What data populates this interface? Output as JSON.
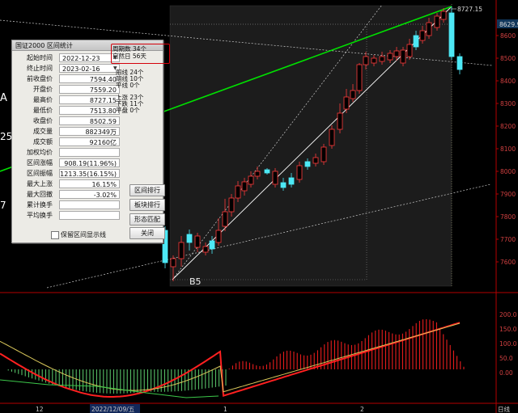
{
  "chart_data": {
    "type": "candlestick",
    "yticks": [
      "8600",
      "8500",
      "8400",
      "8300",
      "8200",
      "8100",
      "8000",
      "7900",
      "7800",
      "7700",
      "7600"
    ],
    "indicator_ticks": [
      "200.0",
      "150.0",
      "100.0",
      "50.0",
      "0.00"
    ],
    "price_tag": "8629.9",
    "high_label": "8727.15",
    "low_label": "B5",
    "x_labels": [
      "12",
      "2022/12/09/五",
      "1",
      "2"
    ],
    "bottom_right_label": "日线",
    "left_edge_labels": [
      "A",
      "25",
      "7"
    ],
    "colors": {
      "up": "#ff3b3b",
      "down": "#4de8f5",
      "trend": "#00dd00",
      "macd": "#ff2020",
      "signal": "#d8c65a"
    }
  },
  "dialog": {
    "title": "国证2000 区间统计",
    "start_label": "起始时间",
    "start_value": "2022-12-23",
    "end_label": "终止时间",
    "end_value": "2023-02-16",
    "fields": [
      {
        "label": "前收盘价",
        "value": "7594.40"
      },
      {
        "label": "开盘价",
        "value": "7559.20"
      },
      {
        "label": "最高价",
        "value": "8727.15"
      },
      {
        "label": "最低价",
        "value": "7513.80"
      },
      {
        "label": "收盘价",
        "value": "8502.59"
      },
      {
        "label": "成交量",
        "value": "882349万"
      },
      {
        "label": "成交额",
        "value": "92160亿"
      },
      {
        "label": "加权均价",
        "value": ""
      },
      {
        "label": "区间涨幅",
        "value": "908.19(11.96%)"
      },
      {
        "label": "区间振幅",
        "value": "1213.35(16.15%)"
      },
      {
        "label": "最大上涨",
        "value": "16.15%"
      },
      {
        "label": "最大回撤",
        "value": "-3.02%"
      },
      {
        "label": "累计换手",
        "value": ""
      },
      {
        "label": "平均换手",
        "value": ""
      }
    ],
    "period_label": "周期数",
    "period_value": "34个",
    "natural_label": "自然日",
    "natural_value": "56天",
    "yang_lines": "阳线 24个",
    "yin_lines": "阴线 10个",
    "flat_lines": "平线 0个",
    "up_days": "上涨 23个",
    "down_days": "下跌 11个",
    "flat_days": "平盘 0个",
    "btn_range_rank": "区间排行",
    "btn_sector_rank": "板块排行",
    "btn_pattern": "形态匹配",
    "btn_close": "关闭",
    "checkbox_label": "保留区间显示线"
  }
}
